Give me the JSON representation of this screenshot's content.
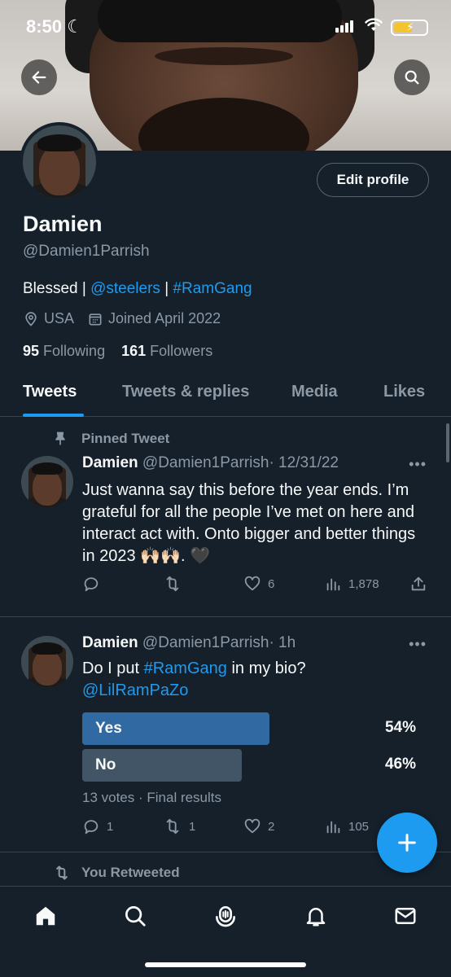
{
  "status_bar": {
    "time": "8:50"
  },
  "profile": {
    "edit_label": "Edit profile",
    "name": "Damien",
    "handle": "@Damien1Parrish",
    "bio": {
      "prefix": "Blessed | ",
      "mention": "@steelers",
      "sep": " | ",
      "hashtag": "#RamGang"
    },
    "location": "USA",
    "joined": "Joined April 2022",
    "following_count": "95",
    "following_label": "Following",
    "followers_count": "161",
    "followers_label": "Followers"
  },
  "tabs": [
    {
      "label": "Tweets"
    },
    {
      "label": "Tweets & replies"
    },
    {
      "label": "Media"
    },
    {
      "label": "Likes"
    }
  ],
  "tweets": [
    {
      "context": "Pinned Tweet",
      "name": "Damien",
      "handle": "@Damien1Parrish",
      "time": "· 12/31/22",
      "text": "Just wanna say this before the year ends. I’m grateful for all the people I’ve met on here and interact act with. Onto bigger and better things in 2023 🙌🏻🙌🏻. 🖤",
      "replies": "",
      "retweets": "",
      "likes": "6",
      "views": "1,878"
    },
    {
      "name": "Damien",
      "handle": "@Damien1Parrish",
      "time": "· 1h",
      "text_prefix": "Do I put ",
      "text_hashtag": "#RamGang",
      "text_suffix": " in my bio?",
      "text_mention": "@LilRamPaZo",
      "poll": {
        "options": [
          {
            "label": "Yes",
            "percent": "54%",
            "fraction": 0.54,
            "winner": true
          },
          {
            "label": "No",
            "percent": "46%",
            "fraction": 0.46,
            "winner": false
          }
        ],
        "meta": "13 votes · Final results"
      },
      "replies": "1",
      "retweets": "1",
      "likes": "2",
      "views": "105"
    }
  ],
  "retweeted_label": "You Retweeted",
  "colors": {
    "background": "#15202b",
    "accent": "#1d9bf0",
    "poll_winner": "#316aa3",
    "poll_loser": "#425566"
  },
  "icons": [
    "back-arrow-icon",
    "search-icon",
    "location-pin-icon",
    "calendar-icon",
    "pin-icon",
    "more-icon",
    "reply-icon",
    "retweet-icon",
    "like-icon",
    "views-icon",
    "share-icon",
    "compose-icon",
    "home-icon",
    "explore-icon",
    "spaces-icon",
    "notifications-icon",
    "messages-icon"
  ]
}
